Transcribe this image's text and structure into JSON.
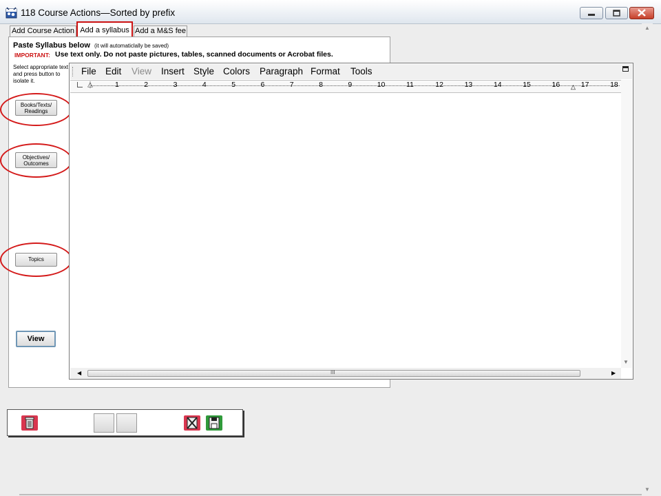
{
  "window": {
    "title": "118 Course Actions—Sorted by prefix",
    "icon": "app-calendar-icon",
    "controls": [
      "minimize-icon",
      "maximize-icon",
      "close-icon"
    ]
  },
  "tabs": [
    {
      "label": "Add Course Action"
    },
    {
      "label": "Add a syllabus",
      "selected": true,
      "highlight_color": "#cc1111"
    },
    {
      "label": "Add a M&S fee"
    }
  ],
  "panel": {
    "heading": "Paste Syllabus below",
    "autosave_note": "(it will automaticlally be saved)",
    "important_label": "IMPORTANT:",
    "important_text": "Use text only.  Do not paste pictures, tables, scanned documents or Acrobat files.",
    "instruction": "Select appropriate text and press button to isolate it."
  },
  "side_buttons": {
    "books": "Books/Texts/\nReadings",
    "objectives": "Objectives/\nOutcomes",
    "topics": "Topics",
    "view": "View"
  },
  "editor": {
    "menu": [
      "File",
      "Edit",
      "View",
      "Insert",
      "Style",
      "Colors",
      "Paragraph",
      "Format",
      "Tools"
    ],
    "disabled_menu": "View",
    "ruler_numbers": [
      "1",
      "2",
      "3",
      "4",
      "5",
      "6",
      "7",
      "8",
      "9",
      "10",
      "11",
      "12",
      "13",
      "14",
      "15",
      "16",
      "17",
      "18"
    ],
    "content": "",
    "hscroll_grip": "III"
  },
  "bottom_toolbar": {
    "buttons": [
      "trash-icon",
      "blank-button",
      "blank-button",
      "cancel-save-icon",
      "save-icon"
    ]
  },
  "colors": {
    "highlight": "#d41a1a",
    "important_text": "#cc1111"
  }
}
